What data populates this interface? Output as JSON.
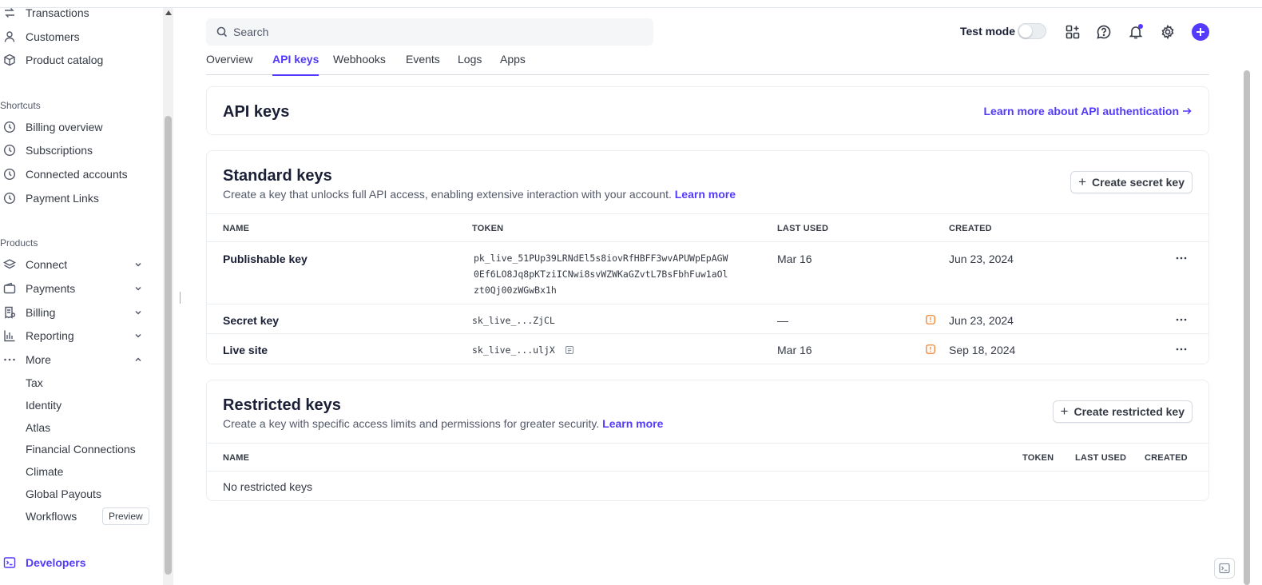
{
  "sidebar": {
    "top_items": [
      {
        "label": "Transactions",
        "icon": "transactions-icon"
      },
      {
        "label": "Customers",
        "icon": "person-icon"
      },
      {
        "label": "Product catalog",
        "icon": "box-icon"
      }
    ],
    "shortcuts_label": "Shortcuts",
    "shortcuts": [
      {
        "label": "Billing overview",
        "icon": "clock-icon"
      },
      {
        "label": "Subscriptions",
        "icon": "clock-icon"
      },
      {
        "label": "Connected accounts",
        "icon": "clock-icon"
      },
      {
        "label": "Payment Links",
        "icon": "clock-icon"
      }
    ],
    "products_label": "Products",
    "products": [
      {
        "label": "Connect",
        "icon": "layers-icon"
      },
      {
        "label": "Payments",
        "icon": "wallet-icon"
      },
      {
        "label": "Billing",
        "icon": "receipt-icon"
      },
      {
        "label": "Reporting",
        "icon": "bar-chart-icon"
      },
      {
        "label": "More",
        "icon": "more-icon"
      }
    ],
    "more_items": [
      {
        "label": "Tax"
      },
      {
        "label": "Identity"
      },
      {
        "label": "Atlas"
      },
      {
        "label": "Financial Connections"
      },
      {
        "label": "Climate"
      },
      {
        "label": "Global Payouts"
      },
      {
        "label": "Workflows"
      }
    ],
    "preview_badge": "Preview",
    "developers": {
      "label": "Developers",
      "icon": "terminal-icon"
    }
  },
  "header": {
    "search_placeholder": "Search",
    "test_mode_label": "Test mode",
    "test_mode_on": false
  },
  "tabs": [
    {
      "label": "Overview",
      "active": false
    },
    {
      "label": "API keys",
      "active": true
    },
    {
      "label": "Webhooks",
      "active": false
    },
    {
      "label": "Events",
      "active": false
    },
    {
      "label": "Logs",
      "active": false
    },
    {
      "label": "Apps",
      "active": false
    }
  ],
  "api_keys": {
    "title": "API keys",
    "learn_more_link": "Learn more about API authentication"
  },
  "standard_keys": {
    "title": "Standard keys",
    "description": "Create a key that unlocks full API access, enabling extensive interaction with your account.",
    "learn_more": "Learn more",
    "create_button": "Create secret key",
    "columns": [
      "NAME",
      "TOKEN",
      "LAST USED",
      "CREATED"
    ],
    "rows": [
      {
        "name": "Publishable key",
        "token_lines": [
          "pk_live_51PUp39LRNdEl5s8iovRfHBFF3wvAPUWpEpAGW",
          "0Ef6LO8Jq8pKTziICNwi8svWZWKaGZvtL7BsFbhFuw1aOl",
          "zt0Qj00zWGwBx1h"
        ],
        "last_used": "Mar 16",
        "created": "Jun 23, 2024"
      },
      {
        "name": "Secret key",
        "token": "sk_live_...ZjCL",
        "last_used": "—",
        "created": "Jun 23, 2024"
      },
      {
        "name": "Live site",
        "token": "sk_live_...uljX",
        "last_used": "Mar 16",
        "created": "Sep 18, 2024"
      }
    ]
  },
  "restricted_keys": {
    "title": "Restricted keys",
    "description": "Create a key with specific access limits and permissions for greater security.",
    "learn_more": "Learn more",
    "create_button": "Create restricted key",
    "columns": [
      "NAME",
      "TOKEN",
      "LAST USED",
      "CREATED"
    ],
    "empty_text": "No restricted keys"
  },
  "colors": {
    "accent": "#533afd",
    "warning": "#f5822c",
    "border": "#ebeef1"
  }
}
